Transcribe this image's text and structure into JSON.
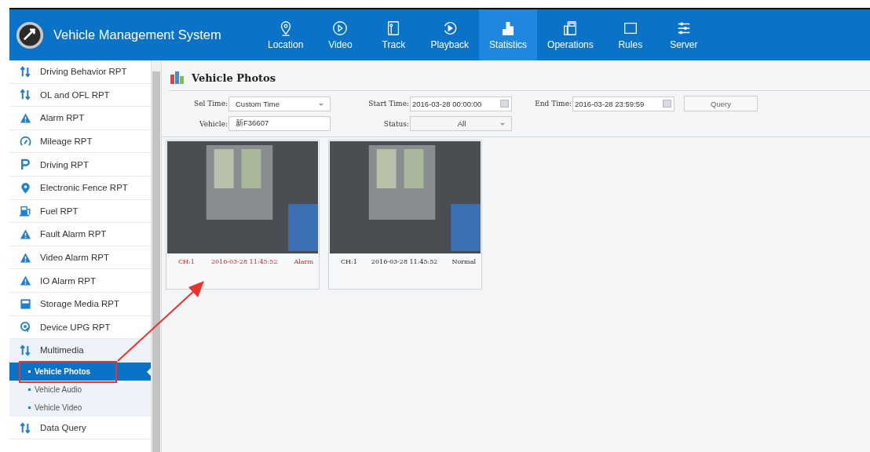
{
  "header": {
    "title": "Vehicle Management System"
  },
  "nav": [
    {
      "label": "Location",
      "kind": "pin",
      "selected": false
    },
    {
      "label": "Video",
      "kind": "play",
      "selected": false
    },
    {
      "label": "Track",
      "kind": "track",
      "selected": false
    },
    {
      "label": "Playback",
      "kind": "replay",
      "selected": false
    },
    {
      "label": "Statistics",
      "kind": "bars",
      "selected": true
    },
    {
      "label": "Operations",
      "kind": "ops",
      "selected": false
    },
    {
      "label": "Rules",
      "kind": "square",
      "selected": false
    },
    {
      "label": "Server",
      "kind": "sliders",
      "selected": false
    }
  ],
  "sidebar": {
    "items": [
      {
        "label": "Driving Behavior RPT",
        "kind": "updown",
        "expanded": false
      },
      {
        "label": "OL and OFL RPT",
        "kind": "updown",
        "expanded": false
      },
      {
        "label": "Alarm RPT",
        "kind": "alarm",
        "expanded": false
      },
      {
        "label": "Mileage RPT",
        "kind": "gauge",
        "expanded": false
      },
      {
        "label": "Driving RPT",
        "kind": "parking",
        "expanded": false
      },
      {
        "label": "Electronic Fence RPT",
        "kind": "pin",
        "expanded": false
      },
      {
        "label": "Fuel RPT",
        "kind": "fuel",
        "expanded": false
      },
      {
        "label": "Fault Alarm RPT",
        "kind": "alarm",
        "expanded": false
      },
      {
        "label": "Video Alarm RPT",
        "kind": "alarm",
        "expanded": false
      },
      {
        "label": "IO Alarm RPT",
        "kind": "alarm",
        "expanded": false
      },
      {
        "label": "Storage Media RPT",
        "kind": "storage",
        "expanded": false
      },
      {
        "label": "Device UPG RPT",
        "kind": "upgrade",
        "expanded": false
      },
      {
        "label": "Multimedia",
        "kind": "updown",
        "expanded": true,
        "children": [
          {
            "label": "Vehicle Photos",
            "selected": true
          },
          {
            "label": "Vehicle Audio",
            "selected": false
          },
          {
            "label": "Vehicle Video",
            "selected": false
          }
        ]
      },
      {
        "label": "Data Query",
        "kind": "updown",
        "expanded": false
      }
    ]
  },
  "content": {
    "title": "Vehicle Photos",
    "form": {
      "sel_time": {
        "label": "Sel Time:",
        "value": "Custom Time"
      },
      "start_time": {
        "label": "Start Time:",
        "value": "2016-03-28 00:00:00"
      },
      "end_time": {
        "label": "End Time:",
        "value": "2016-03-28 23:59:59"
      },
      "query_button": "Query",
      "vehicle": {
        "label": "Vehicle:",
        "value": "新F36607"
      },
      "status": {
        "label": "Status:",
        "value": "All"
      }
    },
    "photos": [
      {
        "channel": "CH:1",
        "time": "2016-03-28 11:45:52",
        "status": "Alarm",
        "alarm": true
      },
      {
        "channel": "CH:1",
        "time": "2016-03-28 11:45:52",
        "status": "Normal",
        "alarm": false
      }
    ]
  }
}
